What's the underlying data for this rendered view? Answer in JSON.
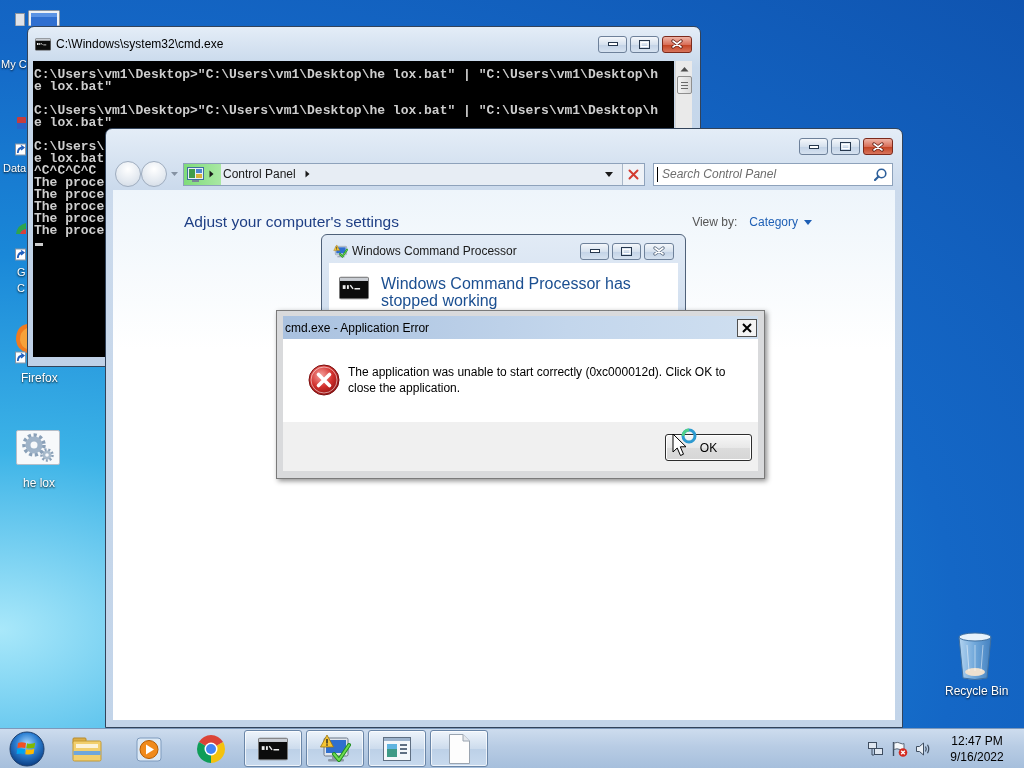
{
  "desktop_icons": [
    {
      "kind": "computer",
      "label": "My C"
    },
    {
      "kind": "shortcut",
      "label": "Data"
    },
    {
      "kind": "browser-shortcut",
      "label_lines": [
        "G",
        "C"
      ]
    },
    {
      "kind": "firefox-shortcut",
      "label": "Firefox"
    },
    {
      "kind": "batch-file",
      "label": "he lox"
    },
    {
      "kind": "recycle-bin",
      "label": "Recycle Bin"
    }
  ],
  "cmd_window": {
    "title": "C:\\Windows\\system32\\cmd.exe",
    "blocks": [
      [
        "C:\\Users\\vm1\\Desktop>\"C:\\Users\\vm1\\Desktop\\he lox.bat\" | \"C:\\Users\\vm1\\Desktop\\h",
        "e lox.bat\""
      ],
      [
        "C:\\Users\\vm1\\Desktop>\"C:\\Users\\vm1\\Desktop\\he lox.bat\" | \"C:\\Users\\vm1\\Desktop\\h",
        "e lox.bat\""
      ],
      [
        "C:\\Users\\",
        "e lox.bat",
        "^C^C^C^C",
        "The proce",
        "The proce",
        "The proce",
        "The proce",
        "The proce"
      ]
    ],
    "cursor_visible": true
  },
  "control_panel": {
    "navigation": {
      "back_disabled": true,
      "forward_disabled": true
    },
    "address": {
      "loading": {
        "level": 0.08
      },
      "breadcrumbs": [
        "Control Panel"
      ]
    },
    "search": {
      "placeholder": "Search Control Panel",
      "focused": true
    },
    "heading": "Adjust your computer's settings",
    "view_by": {
      "label": "View by:",
      "value": "Category"
    }
  },
  "problem_dialog": {
    "title": "Windows Command Processor",
    "message": "Windows Command Processor has stopped working",
    "close_disabled": true
  },
  "error_dialog": {
    "title": "cmd.exe - Application Error",
    "message": "The application was unable to start correctly (0xc000012d). Click OK to close the application.",
    "buttons": [
      {
        "label": "OK",
        "default": true
      }
    ]
  },
  "mouse_cursor": {
    "busy": true
  },
  "taskbar": {
    "items": [
      {
        "kind": "folder",
        "running": false
      },
      {
        "kind": "media-player",
        "running": false
      },
      {
        "kind": "browser",
        "running": false
      },
      {
        "kind": "console",
        "running": true
      },
      {
        "kind": "monitor-warning",
        "running": true
      },
      {
        "kind": "window",
        "running": true
      },
      {
        "kind": "document",
        "running": true
      }
    ],
    "tray": [
      {
        "kind": "network"
      },
      {
        "kind": "flag-alert"
      },
      {
        "kind": "speaker"
      }
    ],
    "clock": {
      "time": "12:47 PM",
      "date": "9/16/2022"
    }
  }
}
